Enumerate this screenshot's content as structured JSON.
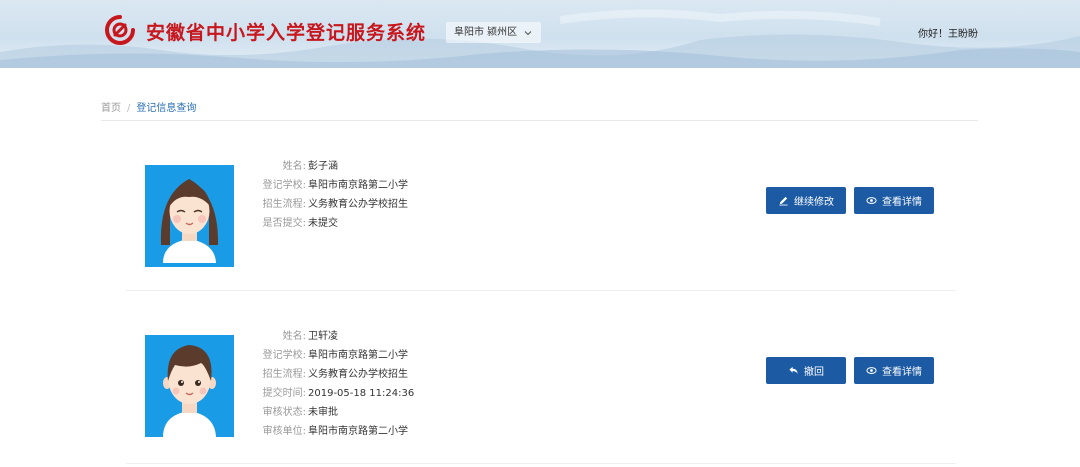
{
  "header": {
    "title": "安徽省中小学入学登记服务系统",
    "region": "阜阳市 颍州区",
    "greeting": "你好！王盼盼"
  },
  "breadcrumb": {
    "home": "首页",
    "separator": "/",
    "current": "登记信息查询"
  },
  "colors": {
    "brand_red": "#c8161d",
    "button_blue": "#1c5aa4",
    "avatar_bg": "#1a9be6",
    "link_blue": "#2a6fb3"
  },
  "records": [
    {
      "fields": [
        {
          "label": "姓名:",
          "value": "彭子涵"
        },
        {
          "label": "登记学校:",
          "value": "阜阳市南京路第二小学"
        },
        {
          "label": "招生流程:",
          "value": "义务教育公办学校招生"
        },
        {
          "label": "是否提交:",
          "value": "未提交"
        }
      ],
      "buttons": [
        {
          "label": "继续修改",
          "icon": "pencil-icon"
        },
        {
          "label": "查看详情",
          "icon": "eye-icon"
        }
      ]
    },
    {
      "fields": [
        {
          "label": "姓名:",
          "value": "卫轩凌"
        },
        {
          "label": "登记学校:",
          "value": "阜阳市南京路第二小学"
        },
        {
          "label": "招生流程:",
          "value": "义务教育公办学校招生"
        },
        {
          "label": "提交时间:",
          "value": "2019-05-18 11:24:36"
        },
        {
          "label": "审核状态:",
          "value": "未审批"
        },
        {
          "label": "审核单位:",
          "value": "阜阳市南京路第二小学"
        }
      ],
      "buttons": [
        {
          "label": "撤回",
          "icon": "undo-icon"
        },
        {
          "label": "查看详情",
          "icon": "eye-icon"
        }
      ]
    }
  ]
}
